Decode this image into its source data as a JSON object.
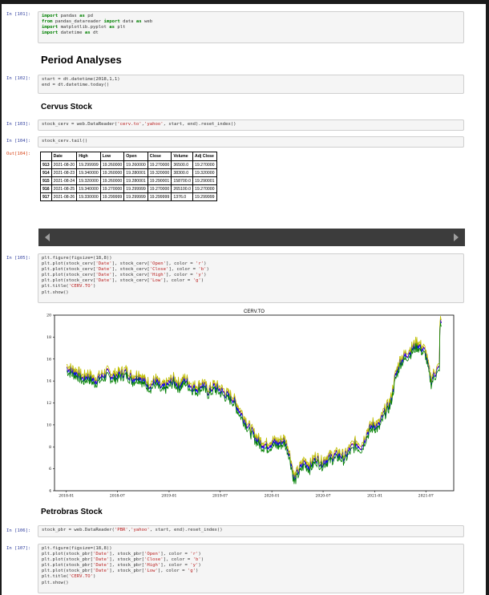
{
  "cells": [
    {
      "prompt": "In [101]:",
      "lines": [
        [
          [
            "kw",
            "import"
          ],
          [
            "t",
            " pandas "
          ],
          [
            "kw",
            "as"
          ],
          [
            "t",
            " pd"
          ]
        ],
        [
          [
            "kw",
            "from"
          ],
          [
            "t",
            " pandas_datareader "
          ],
          [
            "kw",
            "import"
          ],
          [
            "t",
            " data "
          ],
          [
            "kw",
            "as"
          ],
          [
            "t",
            " web"
          ]
        ],
        [
          [
            "kw",
            "import"
          ],
          [
            "t",
            " matplotlib.pyplot "
          ],
          [
            "kw",
            "as"
          ],
          [
            "t",
            " plt"
          ]
        ],
        [
          [
            "kw",
            "import"
          ],
          [
            "t",
            " datetime "
          ],
          [
            "kw",
            "as"
          ],
          [
            "t",
            " dt"
          ]
        ]
      ]
    },
    {
      "prompt": "In [102]:",
      "lines": [
        [
          [
            "t",
            "start = dt.datetime(2018,1,1)"
          ]
        ],
        [
          [
            "t",
            "end = dt.datetime.today()"
          ]
        ]
      ]
    },
    {
      "prompt": "In [103]:",
      "lines": [
        [
          [
            "t",
            "stock_cerv = web.DataReader("
          ],
          [
            "str",
            "'cerv.to'"
          ],
          [
            "t",
            ","
          ],
          [
            "str",
            "'yahoo'"
          ],
          [
            "t",
            ", start, end).reset_index()"
          ]
        ]
      ]
    },
    {
      "prompt": "In [104]:",
      "lines": [
        [
          [
            "t",
            "stock_cerv.tail()"
          ]
        ]
      ]
    },
    {
      "prompt": "In [105]:",
      "lines": [
        [
          [
            "t",
            "plt.figure(figsize=(18,8))"
          ]
        ],
        [
          [
            "t",
            "plt.plot(stock_cerv["
          ],
          [
            "str",
            "'Date'"
          ],
          [
            "t",
            "], stock_cerv["
          ],
          [
            "str",
            "'Open'"
          ],
          [
            "t",
            "], color = "
          ],
          [
            "str",
            "'r'"
          ],
          [
            "t",
            ")"
          ]
        ],
        [
          [
            "t",
            "plt.plot(stock_cerv["
          ],
          [
            "str",
            "'Date'"
          ],
          [
            "t",
            "], stock_cerv["
          ],
          [
            "str",
            "'Close'"
          ],
          [
            "t",
            "], color = "
          ],
          [
            "str",
            "'b'"
          ],
          [
            "t",
            ")"
          ]
        ],
        [
          [
            "t",
            "plt.plot(stock_cerv["
          ],
          [
            "str",
            "'Date'"
          ],
          [
            "t",
            "], stock_cerv["
          ],
          [
            "str",
            "'High'"
          ],
          [
            "t",
            "], color = "
          ],
          [
            "str",
            "'y'"
          ],
          [
            "t",
            ")"
          ]
        ],
        [
          [
            "t",
            "plt.plot(stock_cerv["
          ],
          [
            "str",
            "'Date'"
          ],
          [
            "t",
            "], stock_cerv["
          ],
          [
            "str",
            "'Low'"
          ],
          [
            "t",
            "], color = "
          ],
          [
            "str",
            "'g'"
          ],
          [
            "t",
            ")"
          ]
        ],
        [
          [
            "t",
            "plt.title("
          ],
          [
            "str",
            "'CERV.TO'"
          ],
          [
            "t",
            ")"
          ]
        ],
        [
          [
            "t",
            "plt.show()"
          ]
        ]
      ]
    },
    {
      "prompt": "In [106]:",
      "lines": [
        [
          [
            "t",
            "stock_pbr = web.DataReader("
          ],
          [
            "str",
            "'PBR'"
          ],
          [
            "t",
            ","
          ],
          [
            "str",
            "'yahoo'"
          ],
          [
            "t",
            ", start, end).reset_index()"
          ]
        ]
      ]
    },
    {
      "prompt": "In [107]:",
      "lines": [
        [
          [
            "t",
            "plt.figure(figsize=(18,8))"
          ]
        ],
        [
          [
            "t",
            "plt.plot(stock_pbr["
          ],
          [
            "str",
            "'Date'"
          ],
          [
            "t",
            "], stock_pbr["
          ],
          [
            "str",
            "'Open'"
          ],
          [
            "t",
            "], color = "
          ],
          [
            "str",
            "'r'"
          ],
          [
            "t",
            ")"
          ]
        ],
        [
          [
            "t",
            "plt.plot(stock_pbr["
          ],
          [
            "str",
            "'Date'"
          ],
          [
            "t",
            "], stock_pbr["
          ],
          [
            "str",
            "'Close'"
          ],
          [
            "t",
            "], color = "
          ],
          [
            "str",
            "'b'"
          ],
          [
            "t",
            ")"
          ]
        ],
        [
          [
            "t",
            "plt.plot(stock_pbr["
          ],
          [
            "str",
            "'Date'"
          ],
          [
            "t",
            "], stock_pbr["
          ],
          [
            "str",
            "'High'"
          ],
          [
            "t",
            "], color = "
          ],
          [
            "str",
            "'y'"
          ],
          [
            "t",
            ")"
          ]
        ],
        [
          [
            "t",
            "plt.plot(stock_pbr["
          ],
          [
            "str",
            "'Date'"
          ],
          [
            "t",
            "], stock_pbr["
          ],
          [
            "str",
            "'Low'"
          ],
          [
            "t",
            "], color = "
          ],
          [
            "str",
            "'g'"
          ],
          [
            "t",
            ")"
          ]
        ],
        [
          [
            "t",
            "plt.title("
          ],
          [
            "str",
            "'CERV.TO'"
          ],
          [
            "t",
            ")"
          ]
        ],
        [
          [
            "t",
            "plt.show()"
          ]
        ]
      ]
    }
  ],
  "headings": {
    "period": "Period Analyses",
    "cervus": "Cervus Stock",
    "petrobras": "Petrobras Stock"
  },
  "output_prompt": "Out[104]:",
  "table": {
    "columns": [
      "",
      "Date",
      "High",
      "Low",
      "Open",
      "Close",
      "Volume",
      "Adj Close"
    ],
    "rows": [
      [
        "913",
        "2021-08-20",
        "19.299999",
        "19.260000",
        "19.260000",
        "19.270000",
        "36500.0",
        "19.270000"
      ],
      [
        "914",
        "2021-08-23",
        "19.340000",
        "19.260000",
        "19.280001",
        "19.320000",
        "38300.0",
        "19.320000"
      ],
      [
        "915",
        "2021-08-24",
        "19.320000",
        "19.260000",
        "19.280001",
        "19.290001",
        "158700.0",
        "19.290001"
      ],
      [
        "916",
        "2021-08-25",
        "19.340000",
        "19.270000",
        "19.299999",
        "19.270000",
        "265100.0",
        "19.270000"
      ],
      [
        "917",
        "2021-08-26",
        "19.330000",
        "19.299999",
        "19.299999",
        "19.299999",
        "1376.0",
        "19.299999"
      ]
    ]
  },
  "chart_data": {
    "type": "line",
    "title": "CERV.TO",
    "xlabel": "",
    "ylabel": "",
    "x_tick_labels": [
      "2018-01",
      "2018-07",
      "2019-01",
      "2019-07",
      "2020-01",
      "2020-07",
      "2021-01",
      "2021-07"
    ],
    "y_ticks": [
      4,
      6,
      8,
      10,
      12,
      14,
      16,
      18,
      20
    ],
    "ylim": [
      4,
      20
    ],
    "xlim": [
      "2017-11-20",
      "2021-10-08"
    ],
    "grid": false,
    "line_colors": {
      "Open": "#ff0000",
      "Close": "#0000ff",
      "High": "#bfbf00",
      "Low": "#008000"
    },
    "series_order": [
      "Open",
      "Close",
      "High",
      "Low"
    ],
    "close_points": [
      [
        "2018-01-02",
        15.2
      ],
      [
        "2018-01-20",
        14.9
      ],
      [
        "2018-02-10",
        14.7
      ],
      [
        "2018-03-01",
        14.2
      ],
      [
        "2018-03-20",
        14.5
      ],
      [
        "2018-04-10",
        14.0
      ],
      [
        "2018-05-01",
        14.3
      ],
      [
        "2018-05-25",
        14.7
      ],
      [
        "2018-06-15",
        14.4
      ],
      [
        "2018-07-10",
        14.6
      ],
      [
        "2018-08-01",
        14.8
      ],
      [
        "2018-08-25",
        14.2
      ],
      [
        "2018-09-15",
        14.5
      ],
      [
        "2018-10-10",
        13.8
      ],
      [
        "2018-10-28",
        13.6
      ],
      [
        "2018-11-15",
        14.0
      ],
      [
        "2018-12-05",
        13.3
      ],
      [
        "2018-12-24",
        13.6
      ],
      [
        "2019-01-15",
        14.1
      ],
      [
        "2019-02-05",
        13.6
      ],
      [
        "2019-02-28",
        14.1
      ],
      [
        "2019-03-20",
        13.5
      ],
      [
        "2019-04-10",
        13.3
      ],
      [
        "2019-05-01",
        13.7
      ],
      [
        "2019-05-20",
        13.0
      ],
      [
        "2019-06-10",
        13.5
      ],
      [
        "2019-07-01",
        13.2
      ],
      [
        "2019-07-25",
        12.7
      ],
      [
        "2019-08-15",
        12.4
      ],
      [
        "2019-09-05",
        11.4
      ],
      [
        "2019-09-25",
        10.5
      ],
      [
        "2019-10-15",
        9.6
      ],
      [
        "2019-11-05",
        8.8
      ],
      [
        "2019-11-25",
        8.3
      ],
      [
        "2019-12-15",
        8.1
      ],
      [
        "2020-01-05",
        8.4
      ],
      [
        "2020-01-25",
        8.3
      ],
      [
        "2020-02-15",
        8.6
      ],
      [
        "2020-03-01",
        7.6
      ],
      [
        "2020-03-12",
        6.2
      ],
      [
        "2020-03-20",
        5.0
      ],
      [
        "2020-04-05",
        5.8
      ],
      [
        "2020-04-25",
        6.6
      ],
      [
        "2020-05-15",
        6.2
      ],
      [
        "2020-06-05",
        7.0
      ],
      [
        "2020-06-25",
        6.5
      ],
      [
        "2020-07-15",
        6.9
      ],
      [
        "2020-08-05",
        7.1
      ],
      [
        "2020-08-25",
        7.3
      ],
      [
        "2020-09-15",
        7.0
      ],
      [
        "2020-10-05",
        7.8
      ],
      [
        "2020-10-25",
        8.3
      ],
      [
        "2020-11-15",
        8.0
      ],
      [
        "2020-12-05",
        9.3
      ],
      [
        "2020-12-25",
        10.0
      ],
      [
        "2021-01-15",
        9.9
      ],
      [
        "2021-02-05",
        11.2
      ],
      [
        "2021-02-25",
        12.0
      ],
      [
        "2021-03-15",
        14.4
      ],
      [
        "2021-04-01",
        15.8
      ],
      [
        "2021-04-20",
        16.3
      ],
      [
        "2021-05-10",
        16.8
      ],
      [
        "2021-05-30",
        17.4
      ],
      [
        "2021-06-15",
        17.0
      ],
      [
        "2021-06-30",
        16.6
      ],
      [
        "2021-07-10",
        15.2
      ],
      [
        "2021-07-20",
        14.0
      ],
      [
        "2021-07-30",
        14.6
      ],
      [
        "2021-08-10",
        14.9
      ],
      [
        "2021-08-18",
        15.2
      ],
      [
        "2021-08-20",
        19.27
      ],
      [
        "2021-08-26",
        19.3
      ]
    ]
  }
}
